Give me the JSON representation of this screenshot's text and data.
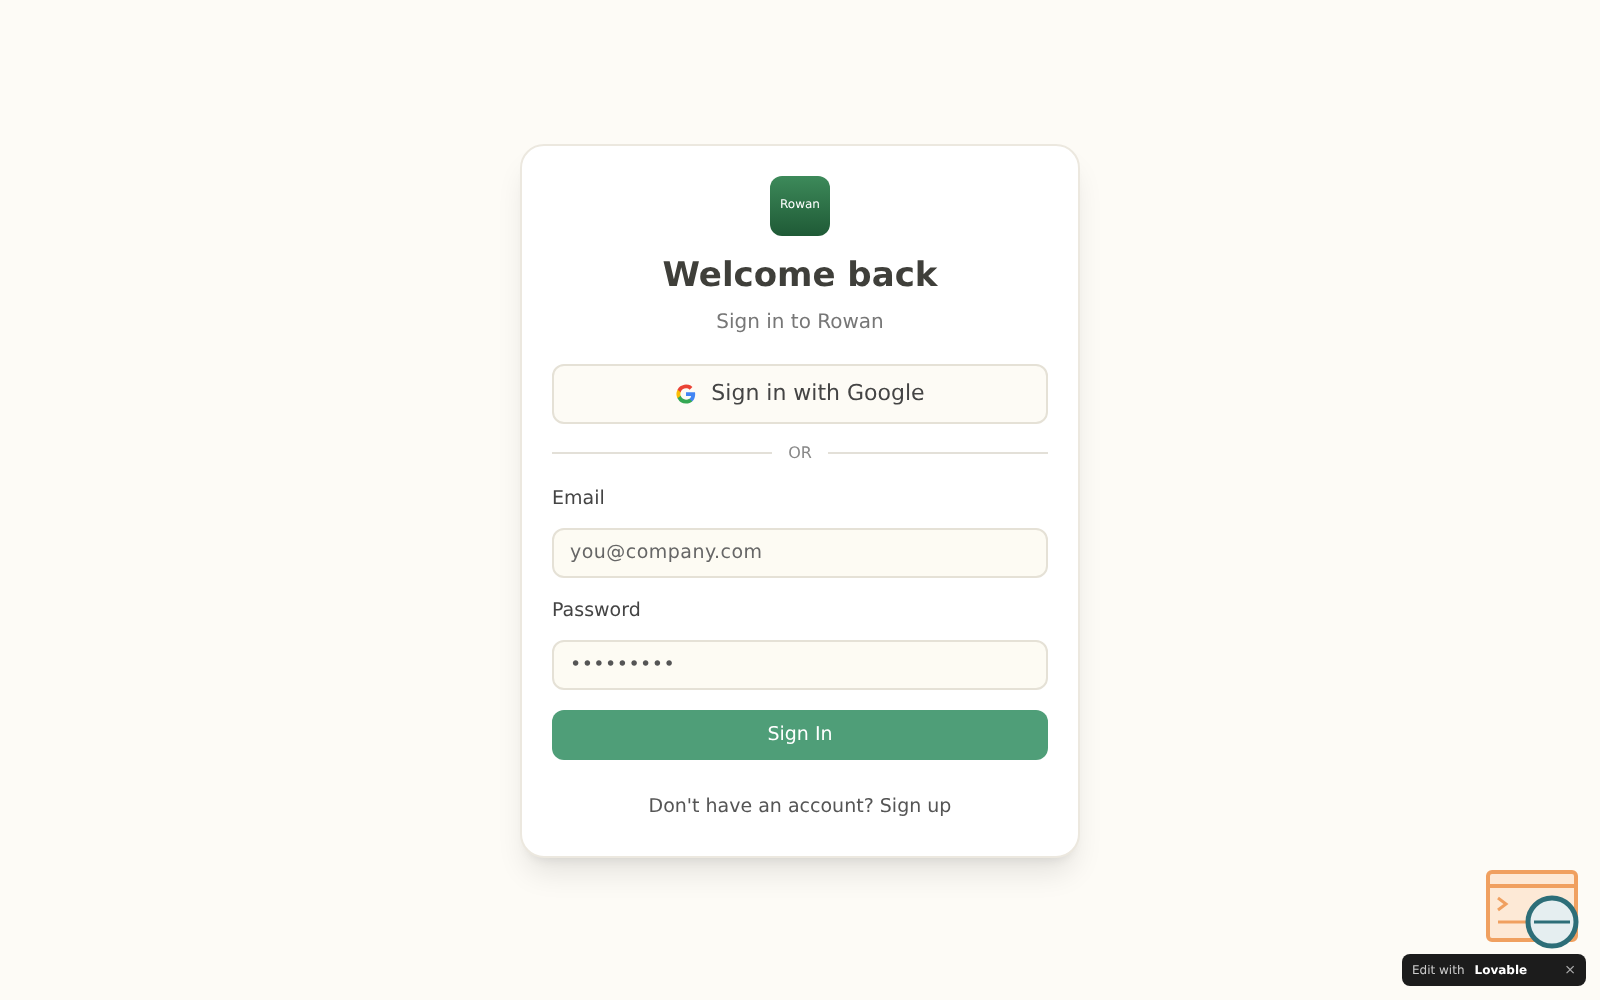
{
  "logo": {
    "text": "Rowan"
  },
  "title": "Welcome back",
  "subtitle": "Sign in to Rowan",
  "google_button": {
    "label": "Sign in with Google"
  },
  "divider": "OR",
  "fields": [
    {
      "label": "Email",
      "placeholder": "you@company.com"
    },
    {
      "label": "Password",
      "value": "•••••••••"
    }
  ],
  "submit": {
    "label": "Sign In"
  },
  "footer": {
    "text": "Don't have an account?",
    "link": "Sign up"
  },
  "badge": {
    "text": "Edit with",
    "brand": "Lovable",
    "close": "×"
  }
}
